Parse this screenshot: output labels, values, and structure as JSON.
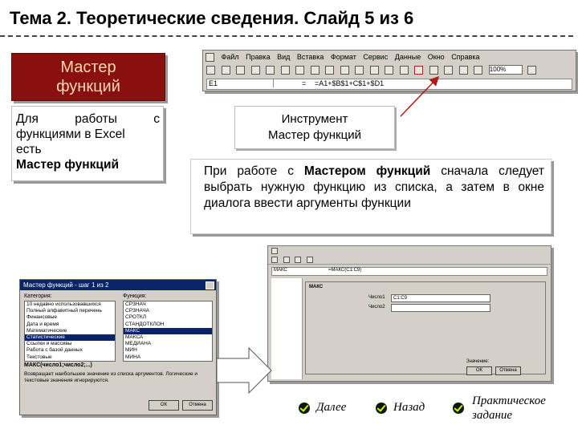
{
  "slide": {
    "title": "Тема 2. Теоретические сведения. Слайд 5 из 6"
  },
  "master": {
    "line1": "Мастер",
    "line2": "функций"
  },
  "description": {
    "line1": "Для работы с",
    "line2": "функциями в Excel",
    "line3": "есть",
    "line4": "Мастер функций"
  },
  "tool_label": {
    "line1": "Инструмент",
    "line2": "Мастер функций"
  },
  "excel_toolbar": {
    "menu": [
      "Файл",
      "Правка",
      "Вид",
      "Вставка",
      "Формат",
      "Сервис",
      "Данные",
      "Окно",
      "Справка"
    ],
    "name_box": "E1",
    "formula_sign": "=",
    "formula": "=A1+$B$1+C$1+$D1",
    "zoom": "100%"
  },
  "paragraph": {
    "p1": "При работе с ",
    "bold1": "Мастером функций",
    "p2": " сначала следует выбрать нужную функцию из списка, а затем в окне диалога ввести аргументы функции"
  },
  "wizard": {
    "title": "Мастер функций - шаг 1 из 2",
    "category_label": "Категория:",
    "function_label": "Функция:",
    "categories": [
      "10 недавно использовавшихся",
      "Полный алфавитный перечень",
      "Финансовые",
      "Дата и время",
      "Математические",
      "Статистические",
      "Ссылки и массивы",
      "Работа с базой данных",
      "Текстовые",
      "Логические",
      "Проверка свойств и значений"
    ],
    "functions": [
      "СРЗНАЧ",
      "СРЗНАЧА",
      "СРОТКЛ",
      "СТАНДОТКЛОН",
      "МАКС",
      "МАКСА",
      "МЕДИАНА",
      "МИН",
      "МИНА",
      "МОДА",
      "НАИБОЛЬШИЙ"
    ],
    "selected_category": 5,
    "selected_function": 4,
    "signature": "МАКС(число1;число2;...)",
    "help": "Возвращает наибольшее значение из списка аргументов. Логические и текстовые значения игнорируются.",
    "ok": "ОК",
    "cancel": "Отмена"
  },
  "args_dialog": {
    "function_name": "МАКС",
    "formula": "=МАКС(C1:C9)",
    "field1_label": "Число1",
    "field1_value": "C1:C9",
    "field2_label": "Число2",
    "result_label": "Значение:",
    "ok": "ОК",
    "cancel": "Отмена"
  },
  "nav": {
    "next": "Далее",
    "back": "Назад",
    "practice_line1": "Практическое",
    "practice_line2": "задание"
  },
  "colors": {
    "master_bg": "#8a1010",
    "master_text": "#ffd9b0",
    "arrow": "#b01a1a",
    "dialog_title": "#0a246a"
  }
}
